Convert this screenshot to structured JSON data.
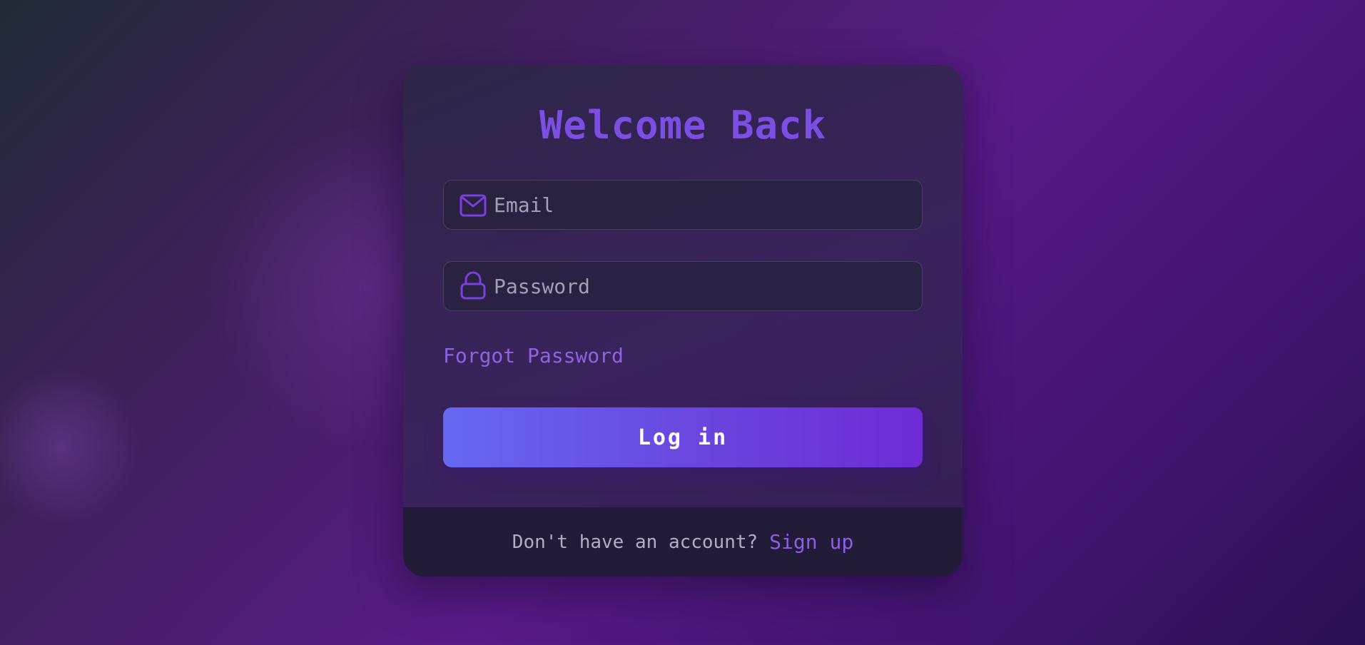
{
  "login": {
    "title": "Welcome Back",
    "email": {
      "placeholder": "Email",
      "value": "",
      "icon": "mail-icon"
    },
    "password": {
      "placeholder": "Password",
      "value": "",
      "icon": "lock-icon"
    },
    "forgot_label": "Forgot Password",
    "login_label": "Log in",
    "footer": {
      "prompt": "Don't have an account?",
      "signup_label": "Sign up"
    }
  },
  "colors": {
    "accent": "#7b4fe3",
    "button_gradient_start": "#6668f2",
    "button_gradient_end": "#6d2bd6",
    "link": "#8e63e6"
  }
}
